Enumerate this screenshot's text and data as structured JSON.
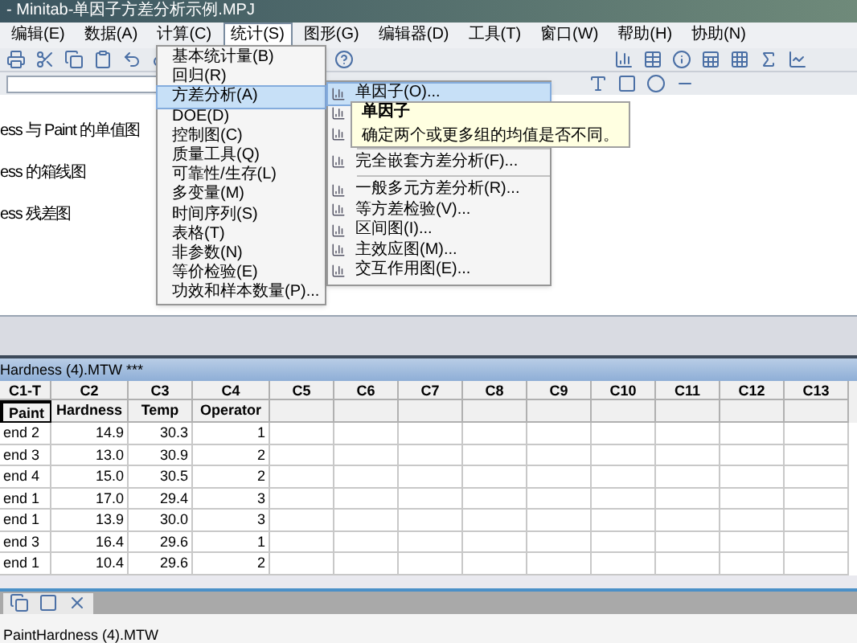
{
  "window": {
    "title": "- Minitab-单因子方差分析示例.MPJ"
  },
  "menubar": [
    {
      "label": "编辑(E)",
      "selected": false
    },
    {
      "label": "数据(A)",
      "selected": false
    },
    {
      "label": "计算(C)",
      "selected": false
    },
    {
      "label": "统计(S)",
      "selected": true
    },
    {
      "label": "图形(G)",
      "selected": false
    },
    {
      "label": "编辑器(D)",
      "selected": false
    },
    {
      "label": "工具(T)",
      "selected": false
    },
    {
      "label": "窗口(W)",
      "selected": false
    },
    {
      "label": "帮助(H)",
      "selected": false
    },
    {
      "label": "协助(N)",
      "selected": false
    }
  ],
  "session": {
    "lines": [
      "ess 与 Paint 的单值图",
      "ess 的箱线图",
      "ess 残差图"
    ]
  },
  "worksheet": {
    "title": "Hardness (4).MTW ***",
    "columns": [
      "C1-T",
      "C2",
      "C3",
      "C4",
      "C5",
      "C6",
      "C7",
      "C8",
      "C9",
      "C10",
      "C11",
      "C12",
      "C13"
    ],
    "names": [
      "Paint",
      "Hardness",
      "Temp",
      "Operator"
    ],
    "rows": [
      [
        "end 2",
        "14.9",
        "30.3",
        "1"
      ],
      [
        "end 3",
        "13.0",
        "30.9",
        "2"
      ],
      [
        "end 4",
        "15.0",
        "30.5",
        "2"
      ],
      [
        "end 1",
        "17.0",
        "29.4",
        "3"
      ],
      [
        "end 1",
        "13.9",
        "30.0",
        "3"
      ],
      [
        "end 3",
        "16.4",
        "29.6",
        "1"
      ],
      [
        "end 1",
        "10.4",
        "29.6",
        "2"
      ]
    ]
  },
  "stat_menu": [
    {
      "label": "基本统计量(B)",
      "selected": false
    },
    {
      "label": "回归(R)",
      "selected": false
    },
    {
      "label": "方差分析(A)",
      "selected": true
    },
    {
      "label": "DOE(D)",
      "selected": false
    },
    {
      "label": "控制图(C)",
      "selected": false
    },
    {
      "label": "质量工具(Q)",
      "selected": false
    },
    {
      "label": "可靠性/生存(L)",
      "selected": false
    },
    {
      "label": "多变量(M)",
      "selected": false
    },
    {
      "label": "时间序列(S)",
      "selected": false
    },
    {
      "label": "表格(T)",
      "selected": false
    },
    {
      "label": "非参数(N)",
      "selected": false
    },
    {
      "label": "等价检验(E)",
      "selected": false
    },
    {
      "label": "功效和样本数量(P)...",
      "selected": false
    }
  ],
  "anova_menu": [
    {
      "label": "单因子(O)...",
      "selected": true,
      "separator": false
    },
    {
      "selected": false,
      "separator": false
    },
    {
      "selected": false,
      "separator": false
    },
    {
      "label": "完全嵌套方差分析(F)...",
      "selected": false,
      "separator": true
    },
    {
      "label": "一般多元方差分析(R)...",
      "selected": false,
      "separator": true
    },
    {
      "label": "等方差检验(V)...",
      "selected": false,
      "separator": false
    },
    {
      "label": "区间图(I)...",
      "selected": false,
      "separator": false
    },
    {
      "label": "主效应图(M)...",
      "selected": false,
      "separator": false
    },
    {
      "label": "交互作用图(E)...",
      "selected": false,
      "separator": false
    }
  ],
  "tooltip": {
    "title": "单因子",
    "text": "确定两个或更多组的均值是否不同。"
  },
  "bottom": {
    "label": "PaintHardness (4).MTW"
  }
}
